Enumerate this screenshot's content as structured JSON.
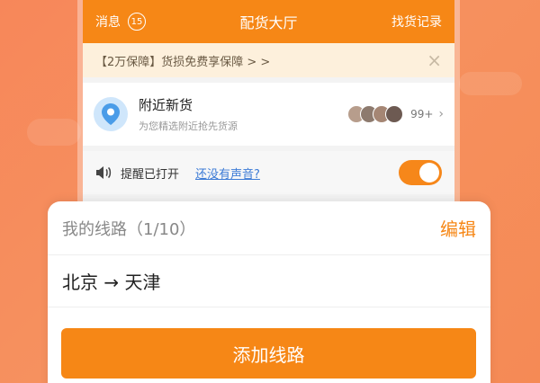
{
  "topbar": {
    "messages_label": "消息",
    "messages_count": "15",
    "title": "配货大厅",
    "records_label": "找货记录"
  },
  "notice": {
    "text": "【2万保障】货损免费享保障 > >",
    "close_symbol": "×"
  },
  "nearby": {
    "title": "附近新货",
    "subtitle": "为您精选附近抢先货源",
    "count": "99+",
    "chevron": "›"
  },
  "reminder": {
    "text": "提醒已打开",
    "link": "还没有声音?",
    "toggle_on": true
  },
  "sheet": {
    "label": "我的线路（1/10）",
    "edit": "编辑",
    "route": "北京 → 天津",
    "add_button": "添加线路"
  },
  "colors": {
    "accent": "#f68716",
    "link": "#3c7bd6",
    "background": "#f58a55"
  }
}
